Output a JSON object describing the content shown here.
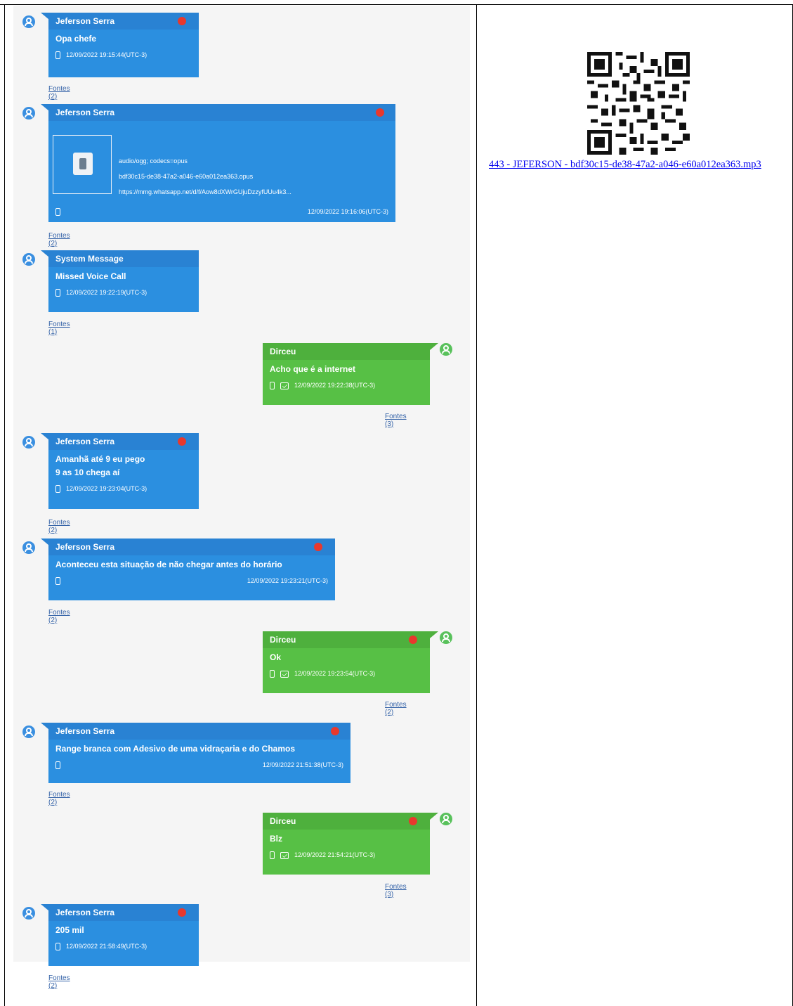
{
  "messages": [
    {
      "side": "left",
      "sender": "Jeferson Serra",
      "text": "Opa chefe",
      "timestamp": "12/09/2022 19:15:44(UTC-3)",
      "sources": "Fontes (2)"
    },
    {
      "side": "left",
      "sender": "Jeferson Serra",
      "text": "",
      "timestamp": "12/09/2022 19:16:06(UTC-3)",
      "sources": "Fontes (2)",
      "attachment": {
        "mime": "audio/ogg; codecs=opus",
        "filename": "bdf30c15-de38-47a2-a046-e60a012ea363.opus",
        "url": "https://mmg.whatsapp.net/d/f/Aow8dXWrGUjuDzzyfUUu4k3..."
      }
    },
    {
      "side": "left",
      "sender": "System Message",
      "text": "Missed Voice Call",
      "timestamp": "12/09/2022 19:22:19(UTC-3)",
      "sources": "Fontes (1)"
    },
    {
      "side": "right",
      "sender": "Dirceu",
      "text": "Acho que é a internet",
      "timestamp": "12/09/2022 19:22:38(UTC-3)",
      "sources": "Fontes (3)"
    },
    {
      "side": "left",
      "sender": "Jeferson Serra",
      "text": "Amanhã até 9 eu pego\n9 as 10 chega aí",
      "timestamp": "12/09/2022 19:23:04(UTC-3)",
      "sources": "Fontes (2)"
    },
    {
      "side": "left",
      "sender": "Jeferson Serra",
      "text": "Aconteceu esta situação de não chegar antes do horário",
      "timestamp": "12/09/2022 19:23:21(UTC-3)",
      "sources": "Fontes (2)"
    },
    {
      "side": "right",
      "sender": "Dirceu",
      "text": "Ok",
      "timestamp": "12/09/2022 19:23:54(UTC-3)",
      "sources": "Fontes (2)"
    },
    {
      "side": "left",
      "sender": "Jeferson Serra",
      "text": "Range branca com Adesivo de uma vidraçaria e do Chamos",
      "timestamp": "12/09/2022 21:51:38(UTC-3)",
      "sources": "Fontes (2)"
    },
    {
      "side": "right",
      "sender": "Dirceu",
      "text": "Blz",
      "timestamp": "12/09/2022 21:54:21(UTC-3)",
      "sources": "Fontes (3)"
    },
    {
      "side": "left",
      "sender": "Jeferson Serra",
      "text": "205 mil",
      "timestamp": "12/09/2022 21:58:49(UTC-3)",
      "sources": "Fontes (2)"
    }
  ],
  "attachment_link": "443 - JEFERSON - bdf30c15-de38-47a2-a046-e60a012ea363.mp3",
  "colors": {
    "incoming": "#2b8fe0",
    "outgoing": "#57c045",
    "unread_dot": "#e8382d",
    "link": "#0000ee"
  }
}
